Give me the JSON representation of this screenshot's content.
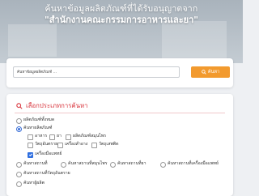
{
  "hero": {
    "line1": "ค้นหาข้อมูลผลิตภัณฑ์ที่ได้รับอนุญาตจาก",
    "line2": "\"สำนักงานคณะกรรมการอาหารและยา\""
  },
  "search": {
    "placeholder": "ค้นหาข้อมูลผลิตภัณฑ์ ...",
    "button_label": "ค้นหา",
    "button_color": "#f29a2e"
  },
  "filters": {
    "title": "เลือกประเภทการค้นหา",
    "title_color": "#d9363e",
    "options": {
      "all": "ผลิตภัณฑ์ทั้งหมด",
      "by_name": "ค้นหาผลิตภัณฑ์",
      "food": "อาหาร",
      "drug": "ยา",
      "narcotic": "ผลิตภัณฑ์สมุนไพร",
      "psychotropic": "วัตถุอันตราย",
      "device": "เครื่องสำอาง",
      "hazardous": "วัตถุเสพติด",
      "cosmetic": "เครื่องมือแพทย์",
      "by_place": "ค้นหาสถานที่",
      "by_herbal_place": "ค้นหาสถานที่สมุนไพร",
      "by_permit": "ค้นหาสถานที่ยา",
      "by_device_place": "ค้นหาสถานที่เครื่องมือแพทย์",
      "by_cosmetic_place": "ค้นหาสถานที่วัตถุอันตราย",
      "by_product": "ค้นหาผู้ผลิต"
    }
  }
}
